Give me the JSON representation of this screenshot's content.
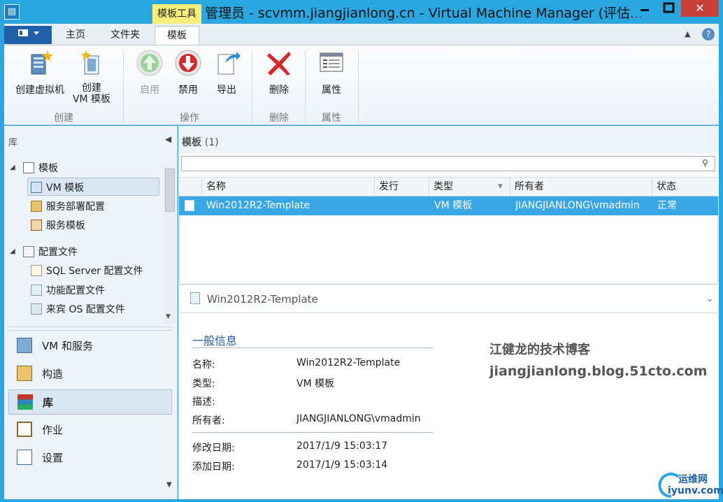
{
  "window": {
    "title": "管理员 - scvmm.jiangjianlong.cn - Virtual Machine Manager (评估...",
    "contextual_tab": "模板工具",
    "close_glyph": "✕"
  },
  "ribbon_tabs": {
    "home": "主页",
    "folder": "文件夹",
    "template": "模板"
  },
  "ribbon": {
    "create_vm": "创建虚拟机",
    "create_template_l1": "创建",
    "create_template_l2": "VM 模板",
    "enable": "启用",
    "disable": "禁用",
    "export": "导出",
    "delete": "删除",
    "properties": "属性",
    "group_create": "创建",
    "group_actions": "操作",
    "group_delete": "删除",
    "group_properties": "属性"
  },
  "left_nav": {
    "header": "库",
    "tree": {
      "templates": "模板",
      "vm_templates": "VM 模板",
      "service_deploy": "服务部署配置",
      "service_templates": "服务模板",
      "profiles": "配置文件",
      "sql_profile": "SQL Server 配置文件",
      "capability_profile": "功能配置文件",
      "guest_os_profile": "来宾 OS 配置文件"
    },
    "workspaces": {
      "vms_services": "VM 和服务",
      "fabric": "构造",
      "library": "库",
      "jobs": "作业",
      "settings": "设置"
    }
  },
  "list": {
    "title": "模板",
    "count": "(1)",
    "search_value": "",
    "columns": [
      "名称",
      "发行",
      "类型",
      "所有者",
      "状态"
    ],
    "rows": [
      {
        "name": "Win2012R2-Template",
        "release": "",
        "type": "VM 模板",
        "owner": "JIANGJIANLONG\\vmadmin",
        "status": "正常"
      }
    ]
  },
  "detail": {
    "name": "Win2012R2-Template",
    "section": "一般信息",
    "labels": {
      "name": "名称:",
      "type": "类型:",
      "description": "描述:",
      "owner": "所有者:",
      "modified": "修改日期:",
      "added": "添加日期:"
    },
    "values": {
      "name": "Win2012R2-Template",
      "type": "VM 模板",
      "description": "",
      "owner": "JIANGJIANLONG\\vmadmin",
      "modified": "2017/1/9 15:03:17",
      "added": "2017/1/9 15:03:14"
    }
  },
  "watermark": {
    "line1": "江健龙的技术博客",
    "line2": "jiangjianlong.blog.51cto.com",
    "logo_top": "运维网",
    "logo_bottom": "iyunv.com"
  },
  "colors": {
    "accent": "#2aa6e0",
    "selection": "#39a7e6",
    "contextual": "#f7ef7a",
    "file_button": "#1f5fa8"
  }
}
